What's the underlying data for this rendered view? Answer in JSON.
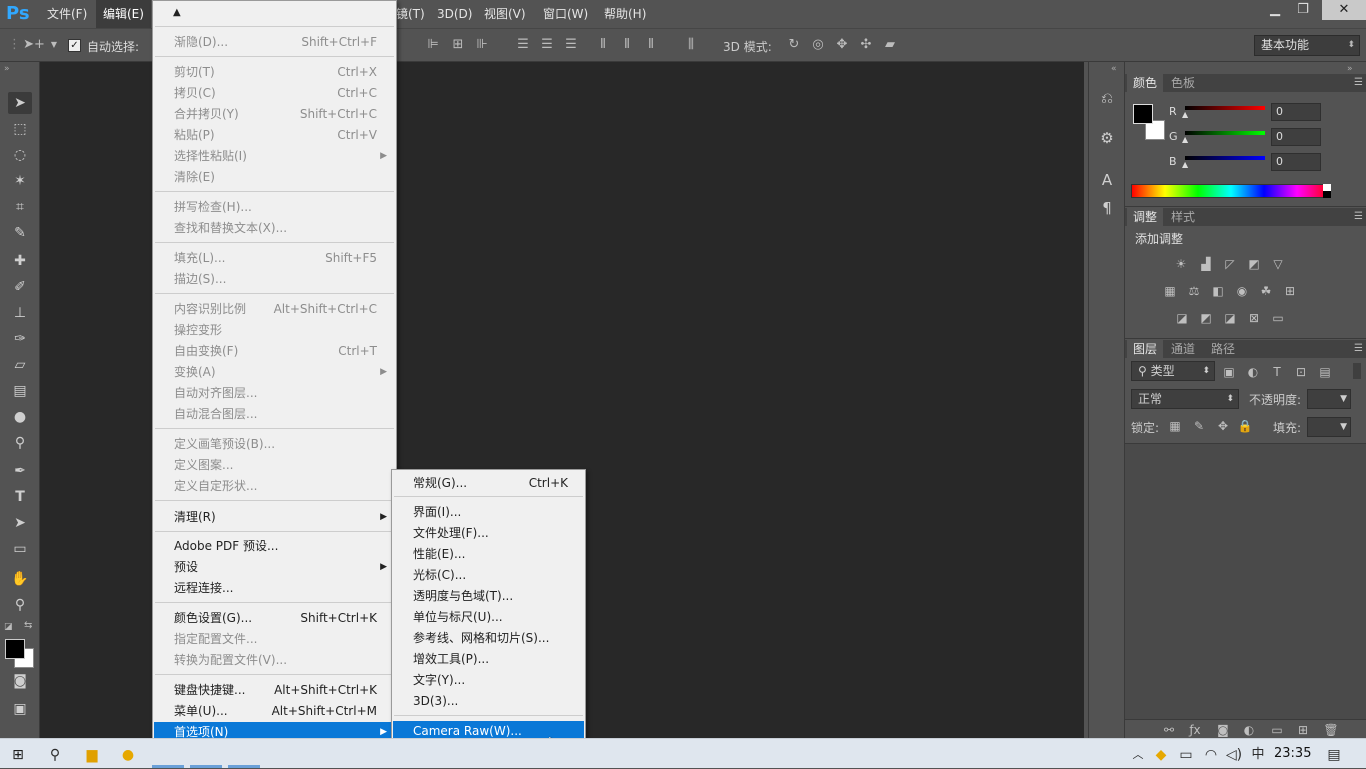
{
  "app": {
    "logo": "Ps"
  },
  "menubar": {
    "items": [
      {
        "label": "文件(F)",
        "active": false
      },
      {
        "label": "编辑(E)",
        "active": true
      },
      {
        "label": "滤镜(T)",
        "active": false
      },
      {
        "label": "3D(D)",
        "active": false
      },
      {
        "label": "视图(V)",
        "active": false
      },
      {
        "label": "窗口(W)",
        "active": false
      },
      {
        "label": "帮助(H)",
        "active": false
      }
    ],
    "partial_label": "镜(T)"
  },
  "optionsbar": {
    "auto_select_label": "自动选择:",
    "mode_3d_label": "3D 模式:",
    "workspace": "基本功能"
  },
  "edit_menu": {
    "scroll_up": "▲",
    "scroll_down": "▼",
    "items": [
      {
        "label": "渐隐(D)...",
        "shortcut": "Shift+Ctrl+F",
        "disabled": true
      },
      {
        "label": "剪切(T)",
        "shortcut": "Ctrl+X",
        "disabled": true
      },
      {
        "label": "拷贝(C)",
        "shortcut": "Ctrl+C",
        "disabled": true
      },
      {
        "label": "合并拷贝(Y)",
        "shortcut": "Shift+Ctrl+C",
        "disabled": true
      },
      {
        "label": "粘贴(P)",
        "shortcut": "Ctrl+V",
        "disabled": true
      },
      {
        "label": "选择性粘贴(I)",
        "shortcut": "",
        "disabled": true,
        "submenu": true
      },
      {
        "label": "清除(E)",
        "shortcut": "",
        "disabled": true
      },
      {
        "label": "拼写检查(H)...",
        "shortcut": "",
        "disabled": true
      },
      {
        "label": "查找和替换文本(X)...",
        "shortcut": "",
        "disabled": true
      },
      {
        "label": "填充(L)...",
        "shortcut": "Shift+F5",
        "disabled": true
      },
      {
        "label": "描边(S)...",
        "shortcut": "",
        "disabled": true
      },
      {
        "label": "内容识别比例",
        "shortcut": "Alt+Shift+Ctrl+C",
        "disabled": true
      },
      {
        "label": "操控变形",
        "shortcut": "",
        "disabled": true
      },
      {
        "label": "自由变换(F)",
        "shortcut": "Ctrl+T",
        "disabled": true
      },
      {
        "label": "变换(A)",
        "shortcut": "",
        "disabled": true,
        "submenu": true
      },
      {
        "label": "自动对齐图层...",
        "shortcut": "",
        "disabled": true
      },
      {
        "label": "自动混合图层...",
        "shortcut": "",
        "disabled": true
      },
      {
        "label": "定义画笔预设(B)...",
        "shortcut": "",
        "disabled": true
      },
      {
        "label": "定义图案...",
        "shortcut": "",
        "disabled": true
      },
      {
        "label": "定义自定形状...",
        "shortcut": "",
        "disabled": true
      },
      {
        "label": "清理(R)",
        "shortcut": "",
        "disabled": false,
        "submenu": true
      },
      {
        "label": "Adobe PDF 预设...",
        "shortcut": "",
        "disabled": false
      },
      {
        "label": "预设",
        "shortcut": "",
        "disabled": false,
        "submenu": true
      },
      {
        "label": "远程连接...",
        "shortcut": "",
        "disabled": false
      },
      {
        "label": "颜色设置(G)...",
        "shortcut": "Shift+Ctrl+K",
        "disabled": false
      },
      {
        "label": "指定配置文件...",
        "shortcut": "",
        "disabled": true
      },
      {
        "label": "转换为配置文件(V)...",
        "shortcut": "",
        "disabled": true
      },
      {
        "label": "键盘快捷键...",
        "shortcut": "Alt+Shift+Ctrl+K",
        "disabled": false
      },
      {
        "label": "菜单(U)...",
        "shortcut": "Alt+Shift+Ctrl+M",
        "disabled": false
      },
      {
        "label": "首选项(N)",
        "shortcut": "",
        "disabled": false,
        "submenu": true,
        "highlight": true
      }
    ]
  },
  "prefs_menu": {
    "items": [
      {
        "label": "常规(G)...",
        "shortcut": "Ctrl+K"
      },
      {
        "label": "界面(I)...",
        "shortcut": ""
      },
      {
        "label": "文件处理(F)...",
        "shortcut": ""
      },
      {
        "label": "性能(E)...",
        "shortcut": ""
      },
      {
        "label": "光标(C)...",
        "shortcut": ""
      },
      {
        "label": "透明度与色域(T)...",
        "shortcut": ""
      },
      {
        "label": "单位与标尺(U)...",
        "shortcut": ""
      },
      {
        "label": "参考线、网格和切片(S)...",
        "shortcut": ""
      },
      {
        "label": "增效工具(P)...",
        "shortcut": ""
      },
      {
        "label": "文字(Y)...",
        "shortcut": ""
      },
      {
        "label": "3D(3)...",
        "shortcut": ""
      },
      {
        "label": "Camera Raw(W)...",
        "shortcut": "",
        "highlight": true
      }
    ]
  },
  "color_panel": {
    "tabs": [
      "颜色",
      "色板"
    ],
    "channels": [
      {
        "label": "R",
        "value": "0",
        "color": "#ff0000"
      },
      {
        "label": "G",
        "value": "0",
        "color": "#00ff00"
      },
      {
        "label": "B",
        "value": "0",
        "color": "#0000ff"
      }
    ]
  },
  "adjust_panel": {
    "tabs": [
      "调整",
      "样式"
    ],
    "title": "添加调整"
  },
  "layers_panel": {
    "tabs": [
      "图层",
      "通道",
      "路径"
    ],
    "filter_kind": "类型",
    "blend_mode": "正常",
    "opacity_label": "不透明度:",
    "lock_label": "锁定:",
    "fill_label": "填充:"
  },
  "taskbar": {
    "ime": "中",
    "time": "23:35"
  }
}
